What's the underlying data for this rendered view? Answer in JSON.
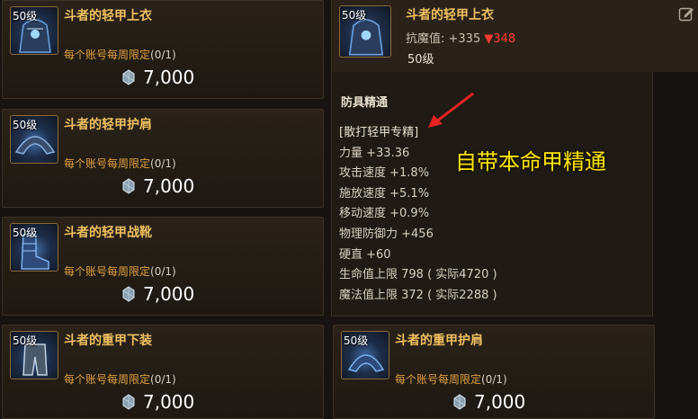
{
  "shop_items": [
    {
      "level": "50级",
      "name": "斗者的轻甲上衣",
      "limit_text": "每个账号每周限定",
      "limit_count": "(0/1)",
      "price": "7,000"
    },
    {
      "level": "50级",
      "name": "斗者的轻甲护肩",
      "limit_text": "每个账号每周限定",
      "limit_count": "(0/1)",
      "price": "7,000"
    },
    {
      "level": "50级",
      "name": "斗者的轻甲战靴",
      "limit_text": "每个账号每周限定",
      "limit_count": "(0/1)",
      "price": "7,000"
    },
    {
      "level": "50级",
      "name": "斗者的重甲下装",
      "limit_text": "每个账号每周限定",
      "limit_count": "(0/1)",
      "price": "7,000"
    },
    {
      "level": "50级",
      "name": "斗者的重甲护肩",
      "limit_text": "每个账号每周限定",
      "limit_count": "(0/1)",
      "price": "7,000"
    }
  ],
  "tooltip": {
    "level": "50级",
    "name": "斗者的轻甲上衣",
    "resist_label": "抗魔值: +335",
    "resist_diff": "▼348",
    "level_text": "50级",
    "section_title": "防具精通",
    "mastery_header": "[散打轻甲专精]",
    "stats": [
      "力量 +33.36",
      "攻击速度 +1.8%",
      "施放速度 +5.1%",
      "移动速度 +0.9%",
      "物理防御力 +456",
      "硬直 +60",
      "生命值上限 798 ( 实际4720 )",
      "魔法值上限 372 ( 实际2288 )"
    ]
  },
  "annotation": "自带本命甲精通",
  "colors": {
    "item_name": "#f0c060",
    "limit": "#e0a040",
    "resist_down": "#ff3b30",
    "annotation": "#ffe600"
  },
  "icons": {
    "coin": "gem-coin-icon",
    "edit": "edit-icon",
    "arrow": "red-arrow-annotation"
  }
}
